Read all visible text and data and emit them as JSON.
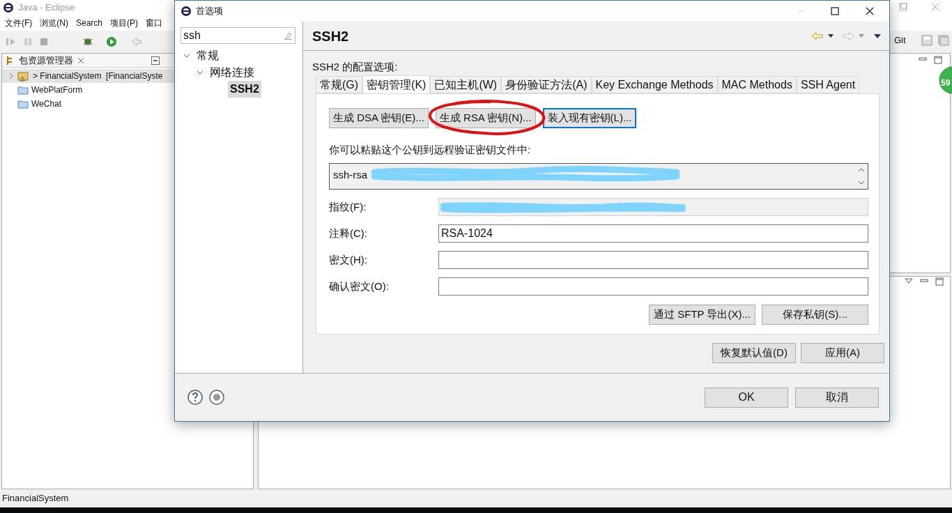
{
  "eclipse": {
    "title": "Java  -  Eclipse",
    "menu": [
      "文件(F)",
      "浏览(N)",
      "Search",
      "项目(P)",
      "窗口"
    ],
    "explorer_tab": "包资源管理器",
    "explorer_items": [
      {
        "kind": "project",
        "label": "> FinancialSystem  [FinancialSyste",
        "selected": true
      },
      {
        "kind": "folder",
        "label": "WebPlatForm",
        "selected": false
      },
      {
        "kind": "folder",
        "label": "WeChat",
        "selected": false
      }
    ],
    "toolbar_label": "Git",
    "badge": "59",
    "status_bar": "FinancialSystem"
  },
  "dialog": {
    "title": "首选项",
    "filter": "ssh",
    "tree": [
      {
        "label": "常规",
        "expanded": true,
        "selected": false,
        "children": [
          {
            "label": "网络连接",
            "expanded": true,
            "selected": false,
            "children": [
              {
                "label": "SSH2",
                "selected": true
              }
            ]
          }
        ]
      }
    ],
    "page_title": "SSH2",
    "description": "SSH2 的配置选项:",
    "tabs": [
      {
        "label": "常规(G)",
        "selected": false
      },
      {
        "label": "密钥管理(K)",
        "selected": true
      },
      {
        "label": "已知主机(W)",
        "selected": false
      },
      {
        "label": "身份验证方法(A)",
        "selected": false
      },
      {
        "label": "Key Exchange Methods",
        "selected": false
      },
      {
        "label": "MAC Methods",
        "selected": false
      },
      {
        "label": "SSH Agent",
        "selected": false
      }
    ],
    "key_buttons": [
      {
        "label": "生成 DSA 密钥(E)...",
        "focused": false
      },
      {
        "label": "生成 RSA 密钥(N)...",
        "focused": false
      },
      {
        "label": "装入现有密钥(L)...",
        "focused": true
      }
    ],
    "public_key_label": "你可以粘贴这个公钥到远程验证密钥文件中:",
    "public_key": "ssh-rsa",
    "fields": [
      {
        "label": "指纹(F):",
        "readonly": true
      },
      {
        "label": "注释(C):",
        "readonly": false,
        "value": "RSA-1024"
      },
      {
        "label": "密文(H):",
        "readonly": false
      },
      {
        "label": "确认密文(O):",
        "readonly": false
      }
    ],
    "export_buttons": [
      "通过 SFTP 导出(X)...",
      "保存私钥(S)..."
    ],
    "page_buttons": [
      "恢复默认值(D)",
      "应用(A)"
    ],
    "footer_buttons": [
      "OK",
      "取消"
    ]
  }
}
